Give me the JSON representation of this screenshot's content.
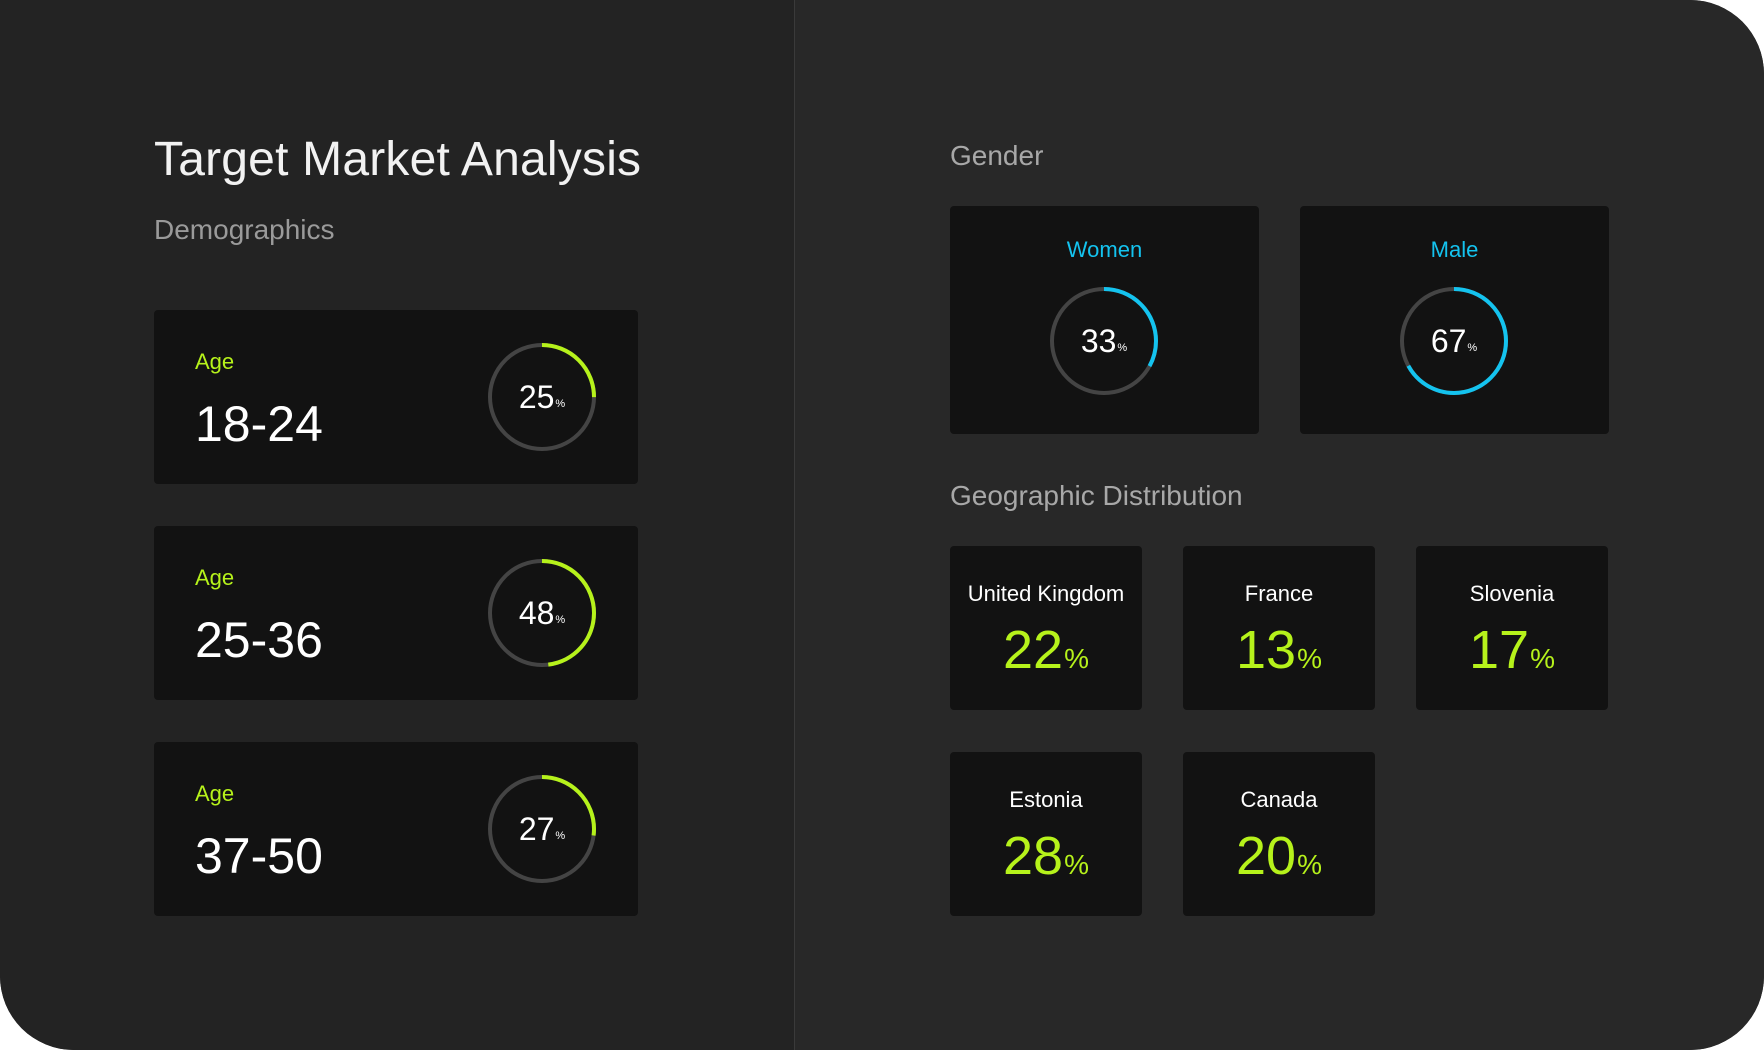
{
  "header": {
    "title": "Target Market Analysis",
    "subtitle": "Demographics"
  },
  "age_groups": [
    {
      "label": "Age",
      "range": "18-24",
      "percent_text": "25",
      "unit": "%",
      "percent": 25
    },
    {
      "label": "Age",
      "range": "25-36",
      "percent_text": "48",
      "unit": "%",
      "percent": 48
    },
    {
      "label": "Age",
      "range": "37-50",
      "percent_text": "27",
      "unit": "%",
      "percent": 27
    }
  ],
  "gender": {
    "section_title": "Gender",
    "items": [
      {
        "label": "Women",
        "percent_text": "33",
        "unit": "%",
        "percent": 33
      },
      {
        "label": "Male",
        "percent_text": "67",
        "unit": "%",
        "percent": 67
      }
    ]
  },
  "geo": {
    "section_title": "Geographic Distribution",
    "items": [
      {
        "country": "United Kingdom",
        "value": "22",
        "unit": "%"
      },
      {
        "country": "France",
        "value": "13",
        "unit": "%"
      },
      {
        "country": "Slovenia",
        "value": "17",
        "unit": "%"
      },
      {
        "country": "Estonia",
        "value": "28",
        "unit": "%"
      },
      {
        "country": "Canada",
        "value": "20",
        "unit": "%"
      }
    ]
  },
  "colors": {
    "accent_green": "#b6f21b",
    "accent_cyan": "#14c3ef",
    "ring_track": "#444444"
  },
  "icons": [
    "progress-ring-icon"
  ]
}
